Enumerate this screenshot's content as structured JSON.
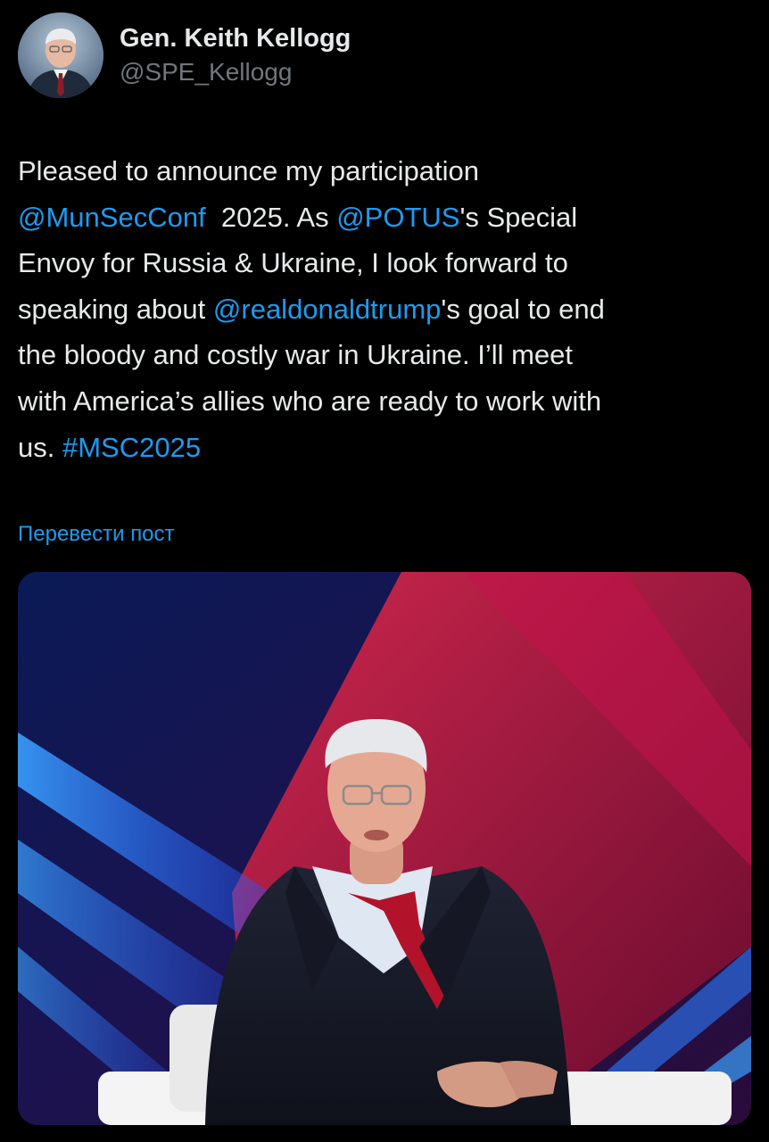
{
  "author": {
    "display_name": "Gen. Keith Kellogg",
    "handle": "@SPE_Kellogg",
    "avatar_icon": "profile-photo"
  },
  "tweet": {
    "lines": [
      [
        {
          "t": "Pleased to announce my participation",
          "k": "text"
        }
      ],
      [
        {
          "t": "@MunSecConf",
          "k": "mention"
        },
        {
          "t": "  2025. As ",
          "k": "text"
        },
        {
          "t": "@POTUS",
          "k": "mention"
        },
        {
          "t": "'s Special",
          "k": "text"
        }
      ],
      [
        {
          "t": "Envoy for Russia & Ukraine, I look forward to",
          "k": "text"
        }
      ],
      [
        {
          "t": "speaking about ",
          "k": "text"
        },
        {
          "t": "@realdonaldtrump",
          "k": "mention"
        },
        {
          "t": "'s goal to end",
          "k": "text"
        }
      ],
      [
        {
          "t": "the bloody and costly war in Ukraine. I’ll meet",
          "k": "text"
        }
      ],
      [
        {
          "t": "with America’s allies who are ready to work with",
          "k": "text"
        }
      ],
      [
        {
          "t": "us. ",
          "k": "text"
        },
        {
          "t": "#MSC2025",
          "k": "hashtag"
        }
      ]
    ]
  },
  "translate_label": "Перевести пост",
  "media": {
    "description_icon": "photo-man-seated-on-stage"
  },
  "colors": {
    "background": "#000000",
    "text": "#e7e9ea",
    "secondary": "#71767b",
    "link": "#1d9bf0"
  }
}
